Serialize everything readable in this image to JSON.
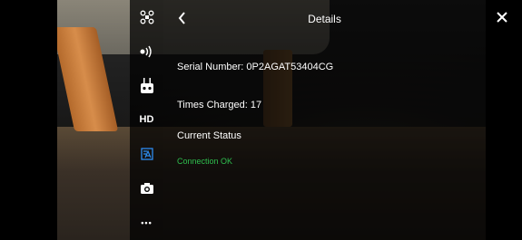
{
  "header": {
    "title": "Details",
    "back_icon": "chevron-left-icon",
    "close_icon": "close-icon"
  },
  "sidebar": {
    "items": [
      {
        "icon": "drone-icon",
        "label": ""
      },
      {
        "icon": "signal-icon",
        "label": ""
      },
      {
        "icon": "remote-controller-icon",
        "label": ""
      },
      {
        "icon": "hd-icon",
        "label": "HD"
      },
      {
        "icon": "battery-icon",
        "label": ""
      },
      {
        "icon": "camera-icon",
        "label": ""
      },
      {
        "icon": "more-icon",
        "label": "•••"
      }
    ],
    "active_color": "#2d8cf0"
  },
  "details": {
    "serial_number": "Serial Number: 0P2AGAT53404CG",
    "times_charged": "Times Charged: 17",
    "current_status_label": "Current Status",
    "current_status_value": "Connection OK",
    "status_color": "#2fbf4e"
  }
}
